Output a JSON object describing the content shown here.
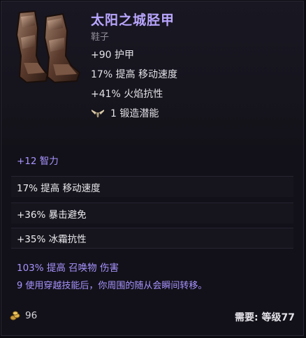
{
  "item": {
    "name": "太阳之城胫甲",
    "type": "鞋子",
    "base_stats": [
      "+90 护甲",
      "17% 提高 移动速度",
      "+41% 火焰抗性"
    ],
    "forge": "1 锻造潜能"
  },
  "affixes": [
    {
      "text": "+12 智力",
      "color": "#a994ff"
    },
    {
      "text": "17% 提高 移动速度",
      "color": "#ececf0"
    },
    {
      "text": "+36% 暴击避免",
      "color": "#ececf0"
    },
    {
      "text": "+35% 冰霜抗性",
      "color": "#ececf0"
    }
  ],
  "unique": {
    "affix": "103% 提高 召唤物 伤害",
    "description": "9 使用穿越技能后，你周围的随从会瞬间转移。"
  },
  "footer": {
    "gold": "96",
    "requirement": "需要: 等级77"
  },
  "icons": {
    "item": "greaves-icon",
    "forge": "forge-hammer-icon",
    "gold": "gold-coins-icon"
  },
  "colors": {
    "title": "#b9a6ff",
    "affix_purple": "#a994ff",
    "panel": "#121119"
  }
}
